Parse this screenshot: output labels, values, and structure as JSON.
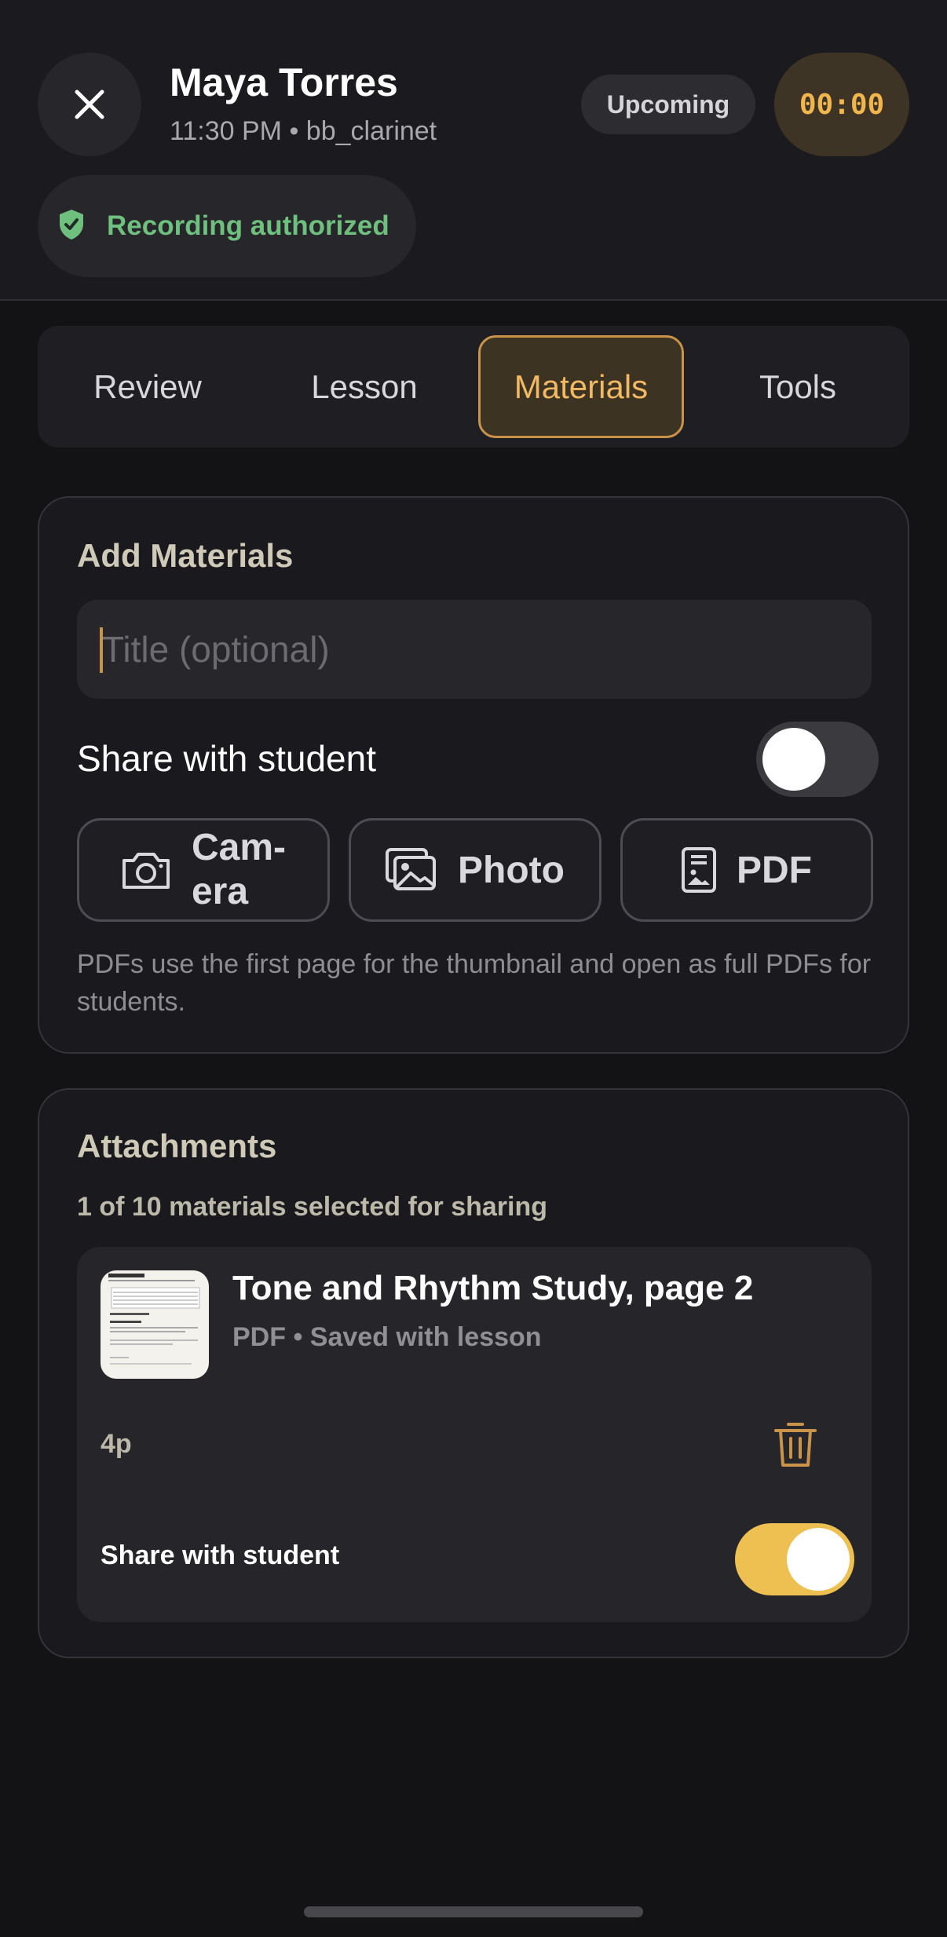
{
  "header": {
    "title": "Maya Torres",
    "subtitle": "11:30 PM • bb_clarinet",
    "status": "Upcoming",
    "timer": "00:00",
    "recording_label": "Recording authorized"
  },
  "tabs": [
    {
      "label": "Review",
      "active": false
    },
    {
      "label": "Lesson",
      "active": false
    },
    {
      "label": "Materials",
      "active": true
    },
    {
      "label": "Tools",
      "active": false
    }
  ],
  "add_materials": {
    "title": "Add Materials",
    "title_input": {
      "placeholder": "Title (optional)",
      "value": ""
    },
    "share_label": "Share with student",
    "share_enabled": false,
    "buttons": {
      "camera_line1": "Cam-",
      "camera_line2": "era",
      "photo": "Photo",
      "pdf": "PDF"
    },
    "hint": "PDFs use the first page for the thumbnail and open as full PDFs for students."
  },
  "attachments": {
    "title": "Attachments",
    "summary": "1 of 10 materials selected for sharing",
    "items": [
      {
        "name": "Tone and Rhythm Study, page 2",
        "meta": "PDF • Saved with lesson",
        "pages": "4p",
        "share_label": "Share with student",
        "share_enabled": true
      }
    ]
  },
  "colors": {
    "accent": "#f2b964",
    "accent_border": "#c9934a",
    "success": "#6fbf7f",
    "toggle_on": "#eec052",
    "background": "#131316"
  },
  "icons": [
    "close-icon",
    "shield-check-icon",
    "camera-icon",
    "photo-icon",
    "pdf-icon",
    "trash-icon"
  ]
}
